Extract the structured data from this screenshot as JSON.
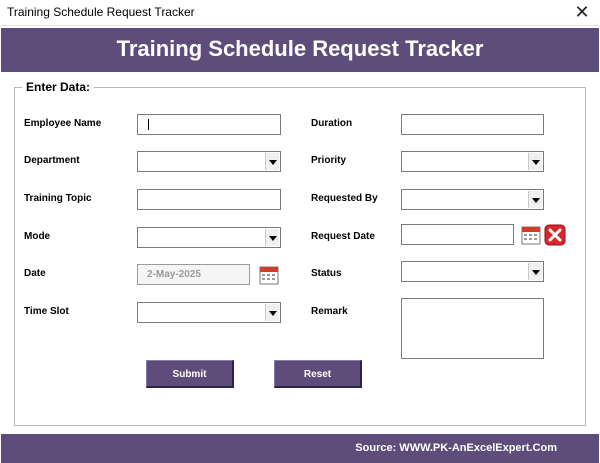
{
  "window": {
    "title": "Training Schedule Request Tracker"
  },
  "header": {
    "title": "Training Schedule Request Tracker"
  },
  "form": {
    "group_label": "Enter Data:",
    "employee_name": {
      "label": "Employee Name",
      "value": ""
    },
    "department": {
      "label": "Department",
      "value": ""
    },
    "training_topic": {
      "label": "Training Topic",
      "value": ""
    },
    "mode": {
      "label": "Mode",
      "value": ""
    },
    "date": {
      "label": "Date",
      "value": "2-May-2025"
    },
    "time_slot": {
      "label": "Time Slot",
      "value": ""
    },
    "duration": {
      "label": "Duration",
      "value": ""
    },
    "priority": {
      "label": "Priority",
      "value": ""
    },
    "requested_by": {
      "label": "Requested By",
      "value": ""
    },
    "request_date": {
      "label": "Request Date",
      "value": ""
    },
    "status": {
      "label": "Status",
      "value": ""
    },
    "remark": {
      "label": "Remark",
      "value": ""
    }
  },
  "buttons": {
    "submit": "Submit",
    "reset": "Reset"
  },
  "footer": {
    "source": "Source: WWW.PK-AnExcelExpert.Com"
  },
  "colors": {
    "brand": "#5e4d7a",
    "close_red": "#d9262b",
    "calendar_red": "#d23a2c"
  },
  "icons": [
    "close-icon",
    "calendar-icon",
    "clear-icon",
    "dropdown-arrow-icon"
  ]
}
